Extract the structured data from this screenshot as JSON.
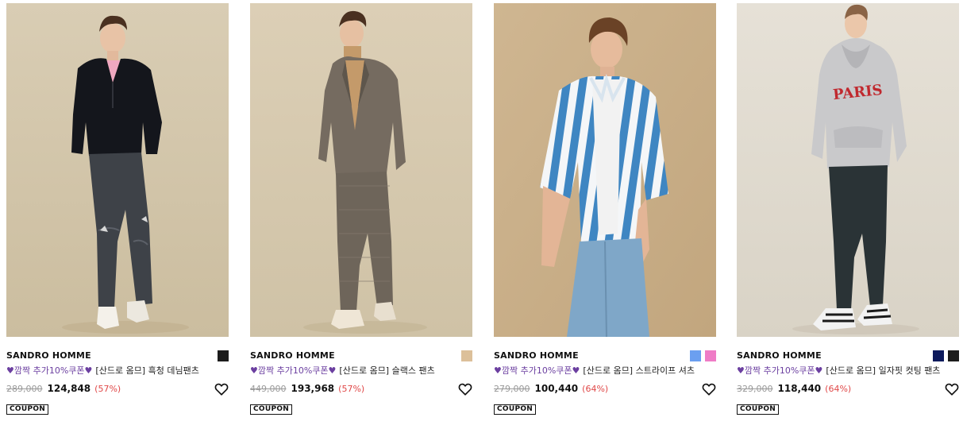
{
  "products": [
    {
      "brand": "SANDRO HOMME",
      "coupon_text": "깜짝 추가10%쿠폰",
      "title": "[산드로 옴므] 흑청 데님팬츠",
      "original_price": "289,000",
      "sale_price": "124,848",
      "discount": "(57%)",
      "coupon_label": "COUPON",
      "swatches": [
        "#1c1c1c"
      ]
    },
    {
      "brand": "SANDRO HOMME",
      "coupon_text": "깜짝 추가10%쿠폰",
      "title": "[산드로 옴므] 슬랙스 팬츠",
      "original_price": "449,000",
      "sale_price": "193,968",
      "discount": "(57%)",
      "coupon_label": "COUPON",
      "swatches": [
        "#dcc09a"
      ]
    },
    {
      "brand": "SANDRO HOMME",
      "coupon_text": "깜짝 추가10%쿠폰",
      "title": "[산드로 옴므] 스트라이프 셔츠",
      "original_price": "279,000",
      "sale_price": "100,440",
      "discount": "(64%)",
      "coupon_label": "COUPON",
      "swatches": [
        "#6b9ff0",
        "#ef7cc6"
      ]
    },
    {
      "brand": "SANDRO HOMME",
      "coupon_text": "깜짝 추가10%쿠폰",
      "title": "[산드로 옴므] 일자핏 컷팅 팬츠",
      "original_price": "329,000",
      "sale_price": "118,440",
      "discount": "(64%)",
      "coupon_label": "COUPON",
      "swatches": [
        "#0d1a5c",
        "#1c1c1c"
      ]
    }
  ],
  "photo_3_print": "PARIS",
  "colors": {
    "coupon_purple": "#6b3fa0",
    "discount_red": "#e04848",
    "strike_gray": "#999999"
  },
  "icons": {
    "heart_mini": "purple-heart-icon",
    "wishlist": "heart-outline-icon"
  }
}
